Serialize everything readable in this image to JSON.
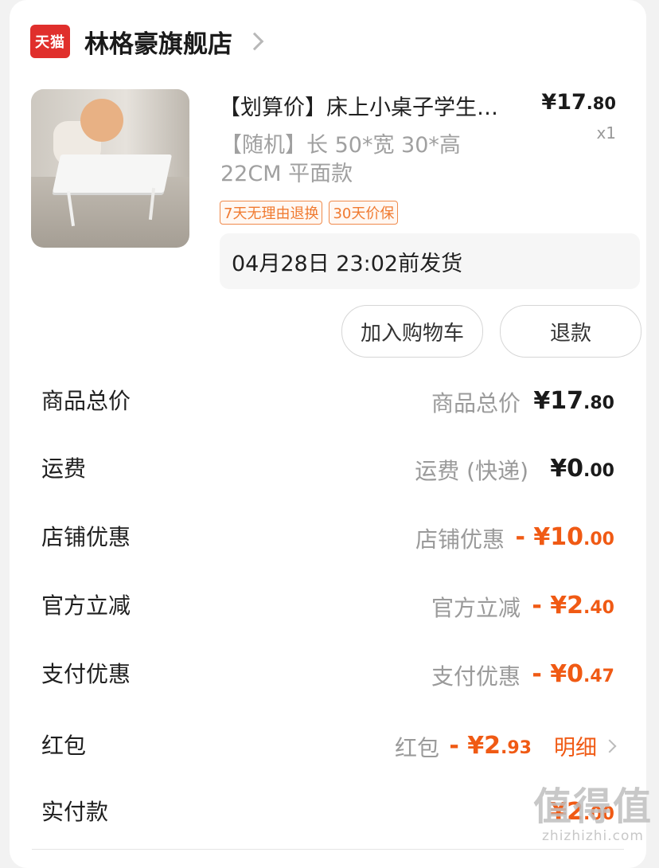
{
  "shop": {
    "logo_text": "天猫",
    "name": "林格豪旗舰店"
  },
  "product": {
    "title": "【划算价】床上小桌子学生…",
    "price_int": "¥17",
    "price_dec": ".80",
    "qty": "x1",
    "spec": "【随机】长 50*宽 30*高 22CM 平面款",
    "tags": [
      "7天无理由退换",
      "30天价保"
    ],
    "ship_text": "04月28日 23:02前发货"
  },
  "buttons": {
    "cart": "加入购物车",
    "refund": "退款"
  },
  "summary": [
    {
      "label": "商品总价",
      "sub": "商品总价",
      "amount_int": "¥17",
      "amount_dec": ".80",
      "red": false
    },
    {
      "label": "运费",
      "sub": "运费 (快递)",
      "amount_int": "¥0",
      "amount_dec": ".00",
      "red": false
    },
    {
      "label": "店铺优惠",
      "sub": "店铺优惠",
      "amount_int": "- ¥10",
      "amount_dec": ".00",
      "red": true
    },
    {
      "label": "官方立减",
      "sub": "官方立减",
      "amount_int": "- ¥2",
      "amount_dec": ".40",
      "red": true
    },
    {
      "label": "支付优惠",
      "sub": "支付优惠",
      "amount_int": "- ¥0",
      "amount_dec": ".47",
      "red": true
    },
    {
      "label": "红包",
      "sub": "红包",
      "amount_int": "- ¥2",
      "amount_dec": ".93",
      "red": true,
      "detail": "明细"
    },
    {
      "label": "实付款",
      "amount_int": "¥2",
      "amount_dec": ".00",
      "red": true
    }
  ],
  "watermark": {
    "big": "值得值",
    "small": "zhizhizhi.com"
  },
  "colors": {
    "accent": "#f05a14",
    "tmall": "#e02f2c",
    "tag": "#f07a30"
  }
}
